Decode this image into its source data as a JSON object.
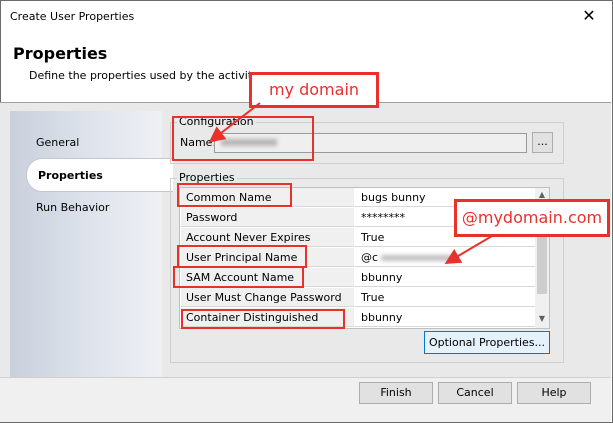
{
  "window": {
    "title": "Create User Properties",
    "close_icon": "close-icon",
    "close_glyph": "✕"
  },
  "header": {
    "title": "Properties",
    "description": "Define the properties used by the activity."
  },
  "sidebar": {
    "items": [
      {
        "label": "General",
        "selected": false
      },
      {
        "label": "Properties",
        "selected": true
      },
      {
        "label": "Run Behavior",
        "selected": false
      }
    ]
  },
  "configuration": {
    "group_title": "Configuration",
    "name_label": "Name:",
    "browse_label": "..."
  },
  "properties": {
    "group_title": "Properties",
    "rows": [
      {
        "name": "Common Name",
        "value": "bugs bunny"
      },
      {
        "name": "Password",
        "value": "********"
      },
      {
        "name": "Account Never Expires",
        "value": "True"
      },
      {
        "name": "User Principal Name",
        "value": "@c"
      },
      {
        "name": "SAM Account Name",
        "value": "bbunny"
      },
      {
        "name": "User Must Change Password",
        "value": "True"
      },
      {
        "name": "Container Distinguished Name",
        "value": "bbunny"
      }
    ],
    "scroll_up_glyph": "▲",
    "scroll_down_glyph": "▼",
    "optional_button": "Optional Properties..."
  },
  "footer": {
    "finish": "Finish",
    "cancel": "Cancel",
    "help": "Help"
  },
  "annotations": {
    "callout_domain": "my domain",
    "callout_email": "@mydomain.com",
    "color": "#e8312b"
  }
}
